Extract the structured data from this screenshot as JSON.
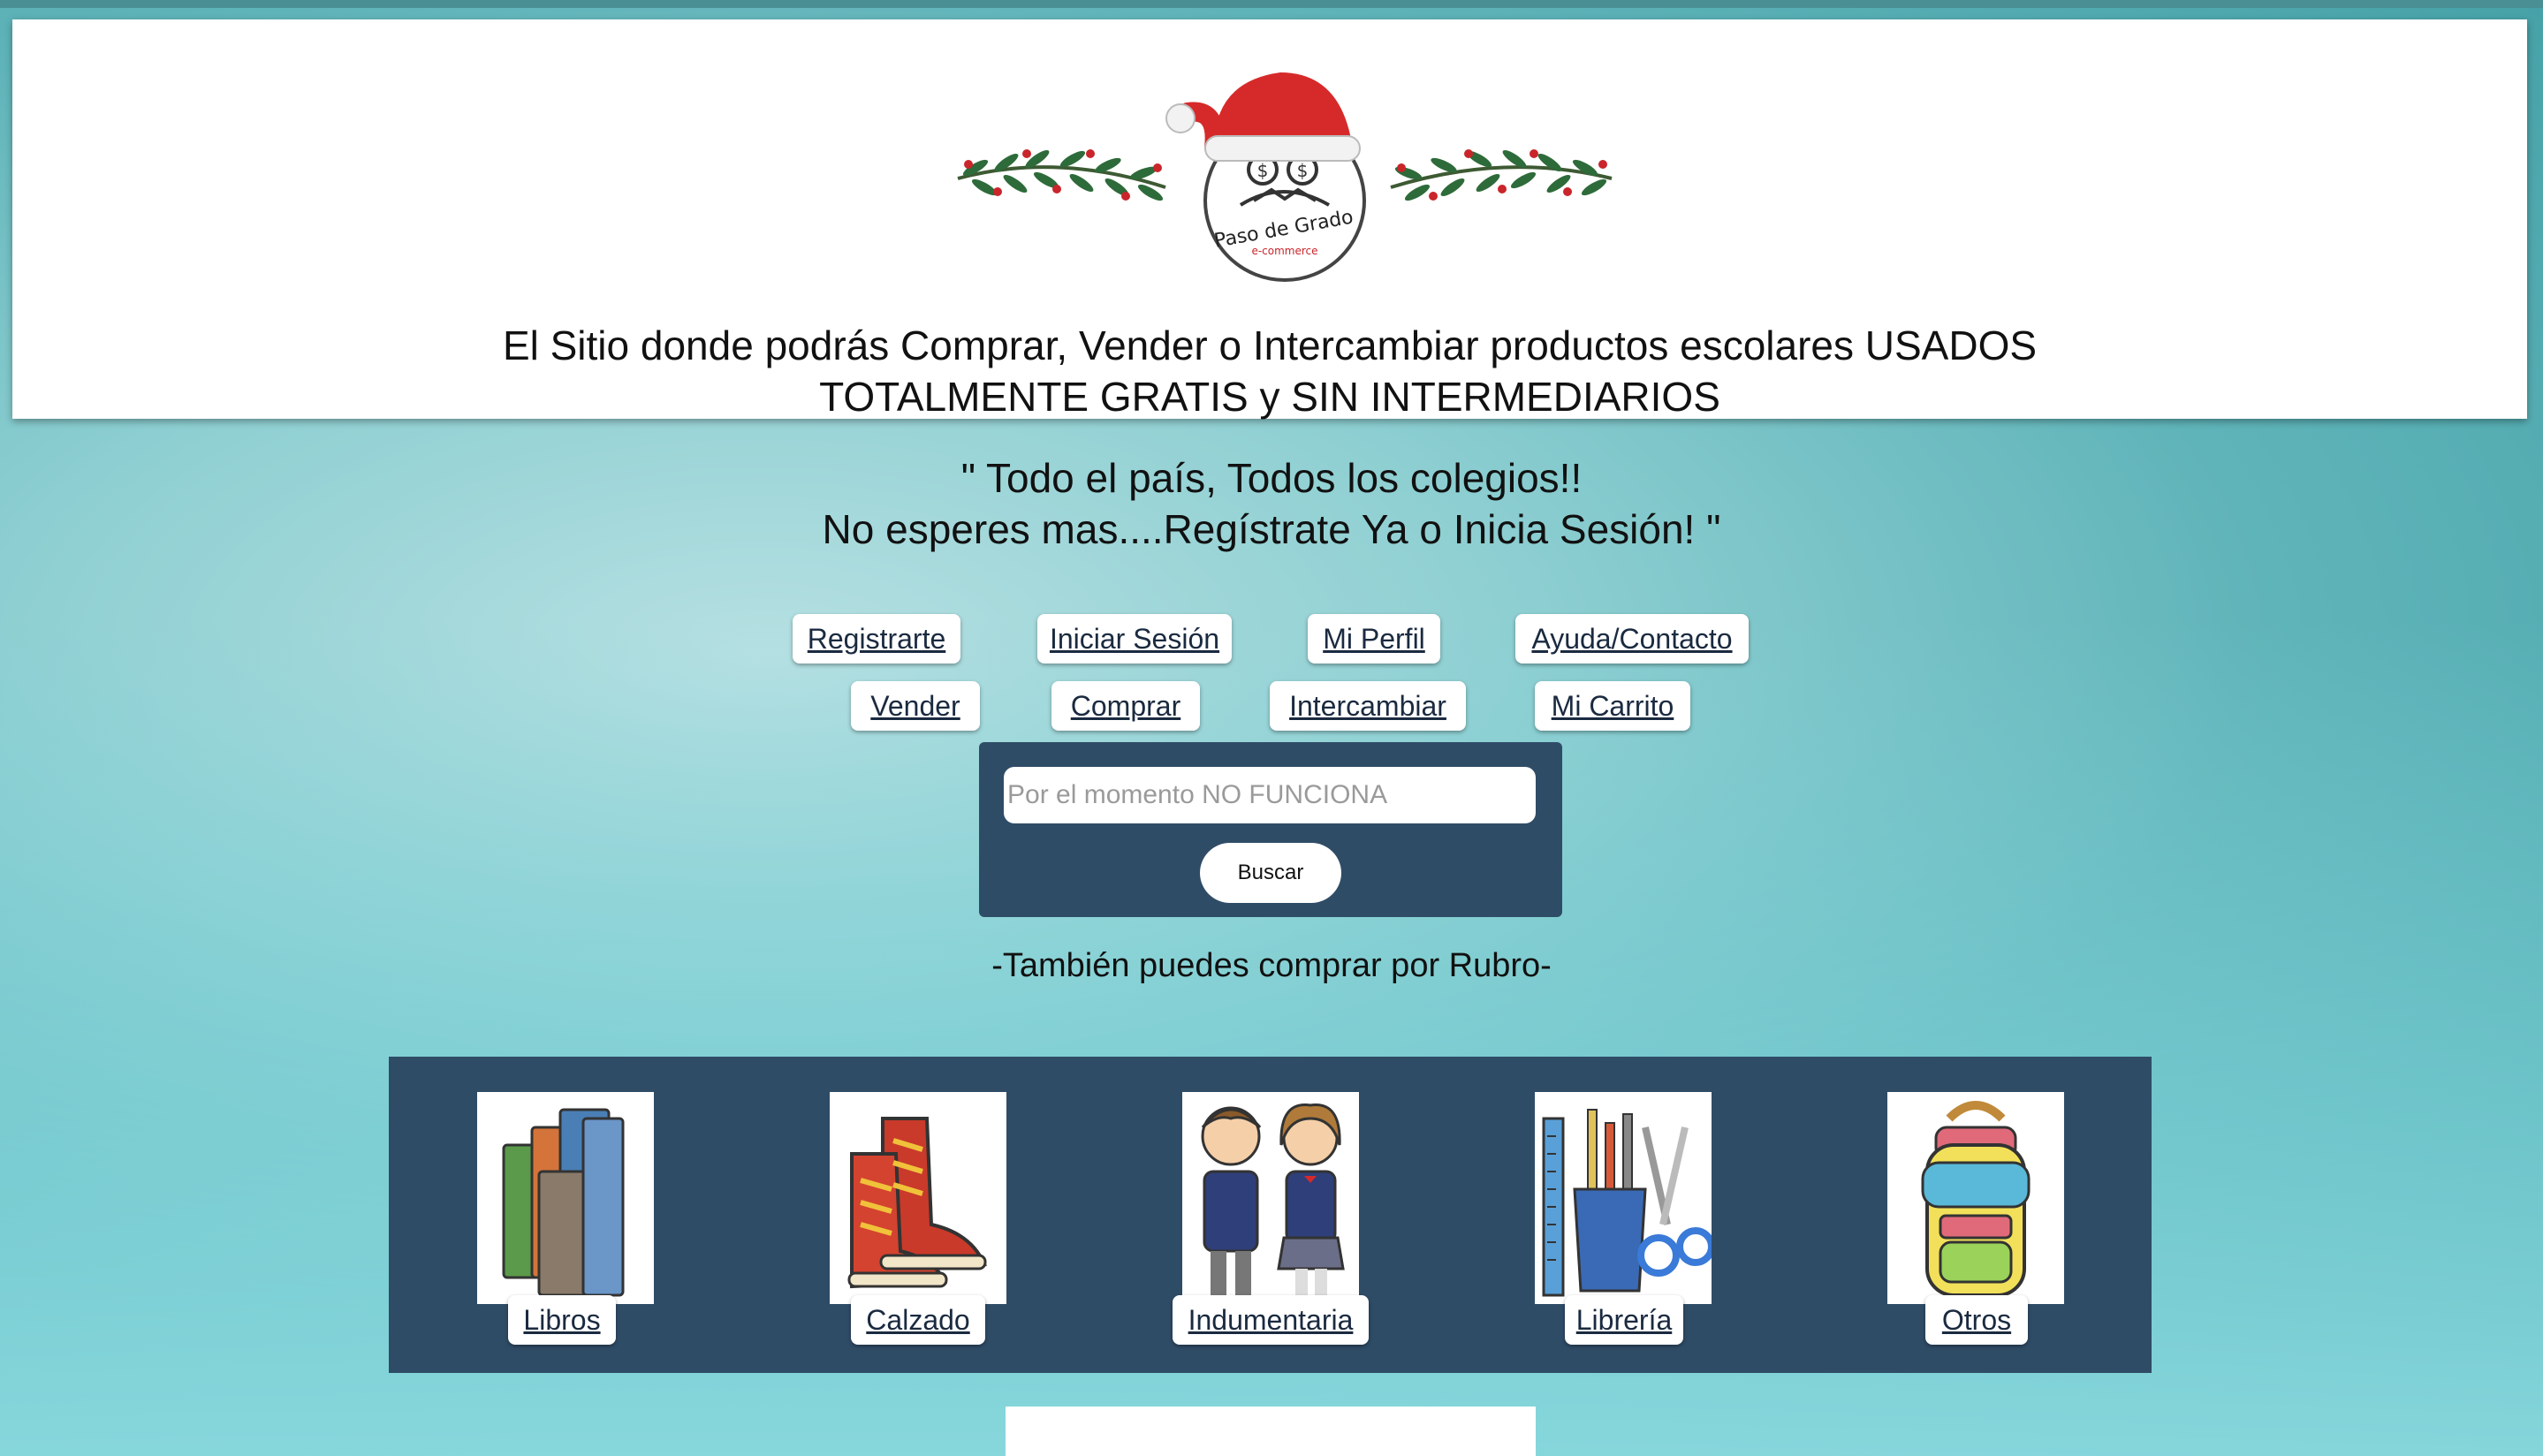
{
  "header": {
    "logo_text": "Paso de Grado",
    "logo_subtext": "e-commerce",
    "tagline_line1": "El Sitio donde podrás Comprar, Vender o Intercambiar productos escolares USADOS",
    "tagline_line2": "TOTALMENTE GRATIS y SIN INTERMEDIARIOS"
  },
  "slogan": {
    "line1": "\" Todo el país, Todos los colegios!!",
    "line2": "No esperes mas....Regístrate Ya o Inicia Sesión! \""
  },
  "nav": {
    "row1": [
      "Registrarte",
      "Iniciar Sesión",
      "Mi Perfil",
      "Ayuda/Contacto"
    ],
    "row2": [
      "Vender ",
      "Comprar ",
      "Intercambiar ",
      "Mi Carrito"
    ]
  },
  "search": {
    "placeholder": "Por el momento NO FUNCIONA",
    "button_label": "Buscar"
  },
  "rubro_title": "-También puedes comprar por Rubro-",
  "categories": [
    {
      "label": "Libros",
      "icon": "books-icon"
    },
    {
      "label": "Calzado",
      "icon": "shoes-icon"
    },
    {
      "label": "Indumentaria",
      "icon": "uniform-kids-icon"
    },
    {
      "label": "Librería",
      "icon": "stationery-icon"
    },
    {
      "label": "Otros",
      "icon": "backpack-icon"
    }
  ],
  "colors": {
    "panel": "#2f4c67",
    "santa_hat": "#d62a2a",
    "garland": "#2e6b3a"
  }
}
